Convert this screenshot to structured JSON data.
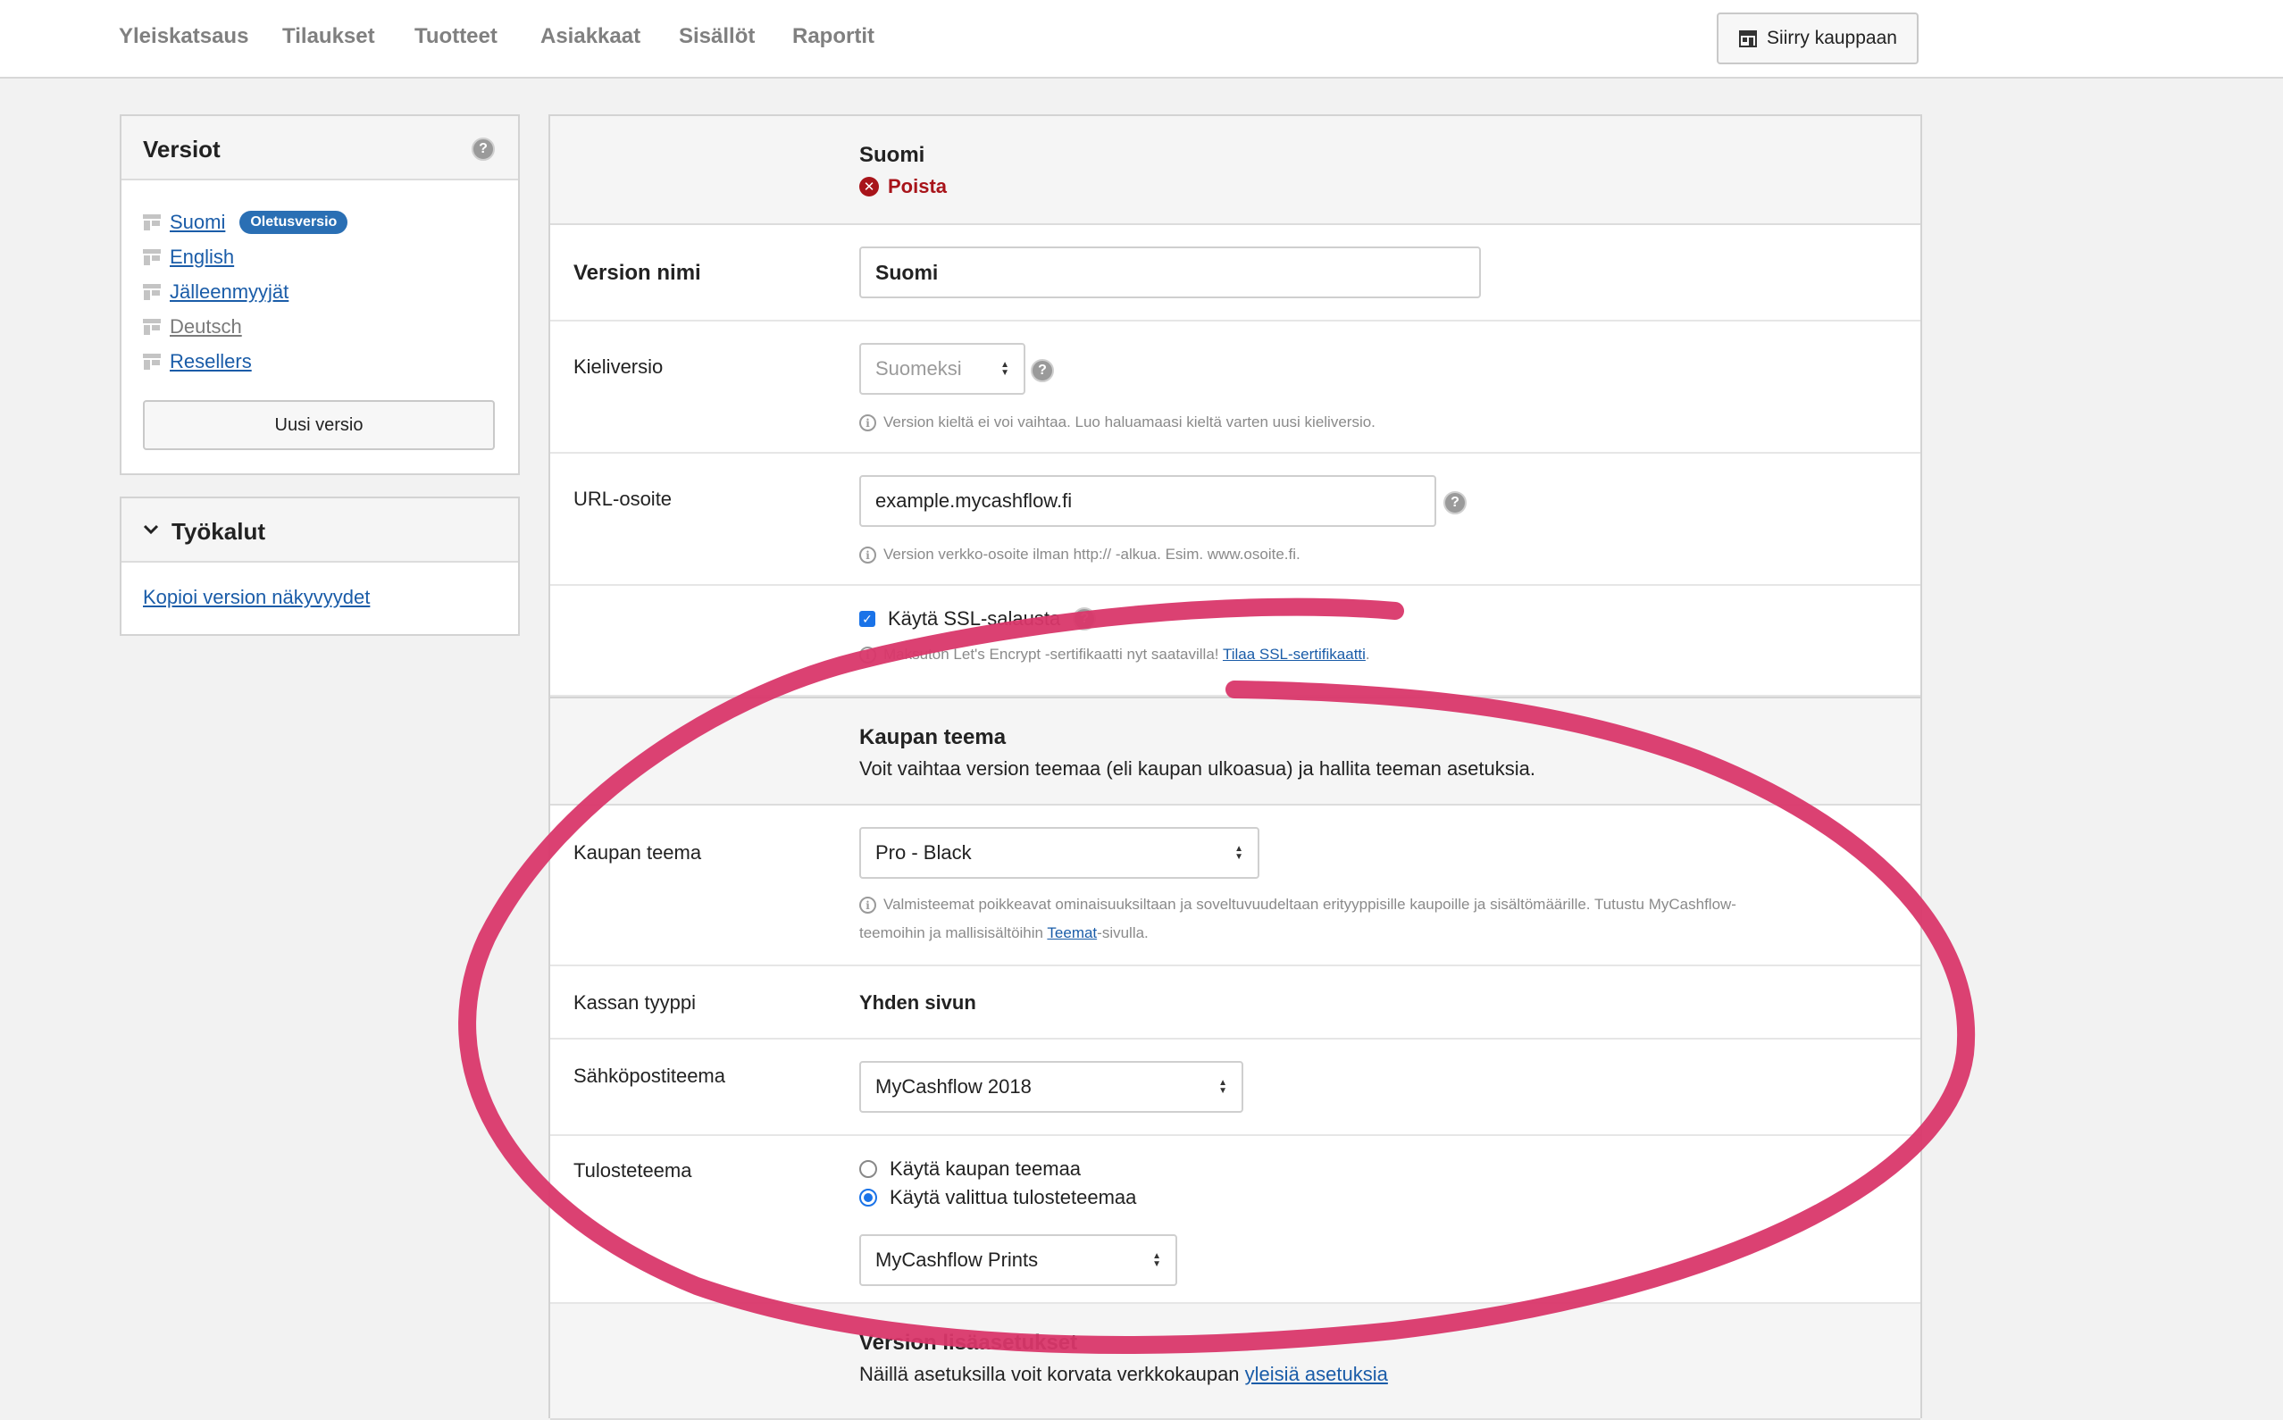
{
  "nav": {
    "items": [
      "Yleiskatsaus",
      "Tilaukset",
      "Tuotteet",
      "Asiakkaat",
      "Sisällöt",
      "Raportit"
    ],
    "store_button": "Siirry kauppaan"
  },
  "versions_panel": {
    "title": "Versiot",
    "items": [
      {
        "label": "Suomi",
        "badge": "Oletusversio",
        "linked": true
      },
      {
        "label": "English",
        "linked": true
      },
      {
        "label": "Jälleenmyyjät",
        "linked": true
      },
      {
        "label": "Deutsch",
        "linked": false
      },
      {
        "label": "Resellers",
        "linked": true
      }
    ],
    "new_button": "Uusi versio"
  },
  "tools_panel": {
    "title": "Työkalut",
    "link": "Kopioi version näkyvyydet"
  },
  "main": {
    "header": {
      "title": "Suomi",
      "delete_label": "Poista"
    },
    "version_name": {
      "label": "Version nimi",
      "value": "Suomi"
    },
    "language": {
      "label": "Kieliversio",
      "value": "Suomeksi",
      "hint": "Version kieltä ei voi vaihtaa. Luo haluamaasi kieltä varten uusi kieliversio."
    },
    "url": {
      "label": "URL-osoite",
      "value": "example.mycashflow.fi",
      "hint": "Version verkko-osoite ilman http:// -alkua. Esim. www.osoite.fi."
    },
    "ssl": {
      "label": "Käytä SSL-salausta",
      "checked": true,
      "hint_text": "Maksuton Let's Encrypt -sertifikaatti nyt saatavilla!",
      "hint_link": "Tilaa SSL-sertifikaatti",
      "hint_end": "."
    },
    "theme_section": {
      "title": "Kaupan teema",
      "description": "Voit vaihtaa version teemaa (eli kaupan ulkoasua) ja hallita teeman asetuksia."
    },
    "store_theme": {
      "label": "Kaupan teema",
      "value": "Pro - Black",
      "hint_line1": "Valmisteemat poikkeavat ominaisuuksiltaan ja soveltuvuudeltaan erityyppisille kaupoille ja sisältömäärille. Tutustu MyCashflow-",
      "hint_line2_pre": "teemoihin ja mallisisältöihin",
      "hint_link": "Teemat",
      "hint_line2_post": "-sivulla."
    },
    "checkout": {
      "label": "Kassan tyyppi",
      "value": "Yhden sivun"
    },
    "email_theme": {
      "label": "Sähköpostiteema",
      "value": "MyCashflow 2018"
    },
    "print_theme": {
      "label": "Tulosteteema",
      "option1": "Käytä kaupan teemaa",
      "option2": "Käytä valittua tulosteteemaa",
      "selected": 2,
      "value": "MyCashflow Prints"
    },
    "extra_section": {
      "title": "Version lisäasetukset",
      "description": "Näillä asetuksilla voit korvata verkkokaupan",
      "link": "yleisiä asetuksia"
    }
  },
  "colors": {
    "accent": "#2a6fb4",
    "link": "#1a5ca8",
    "danger": "#a8141a",
    "annotation": "#d9376a"
  }
}
